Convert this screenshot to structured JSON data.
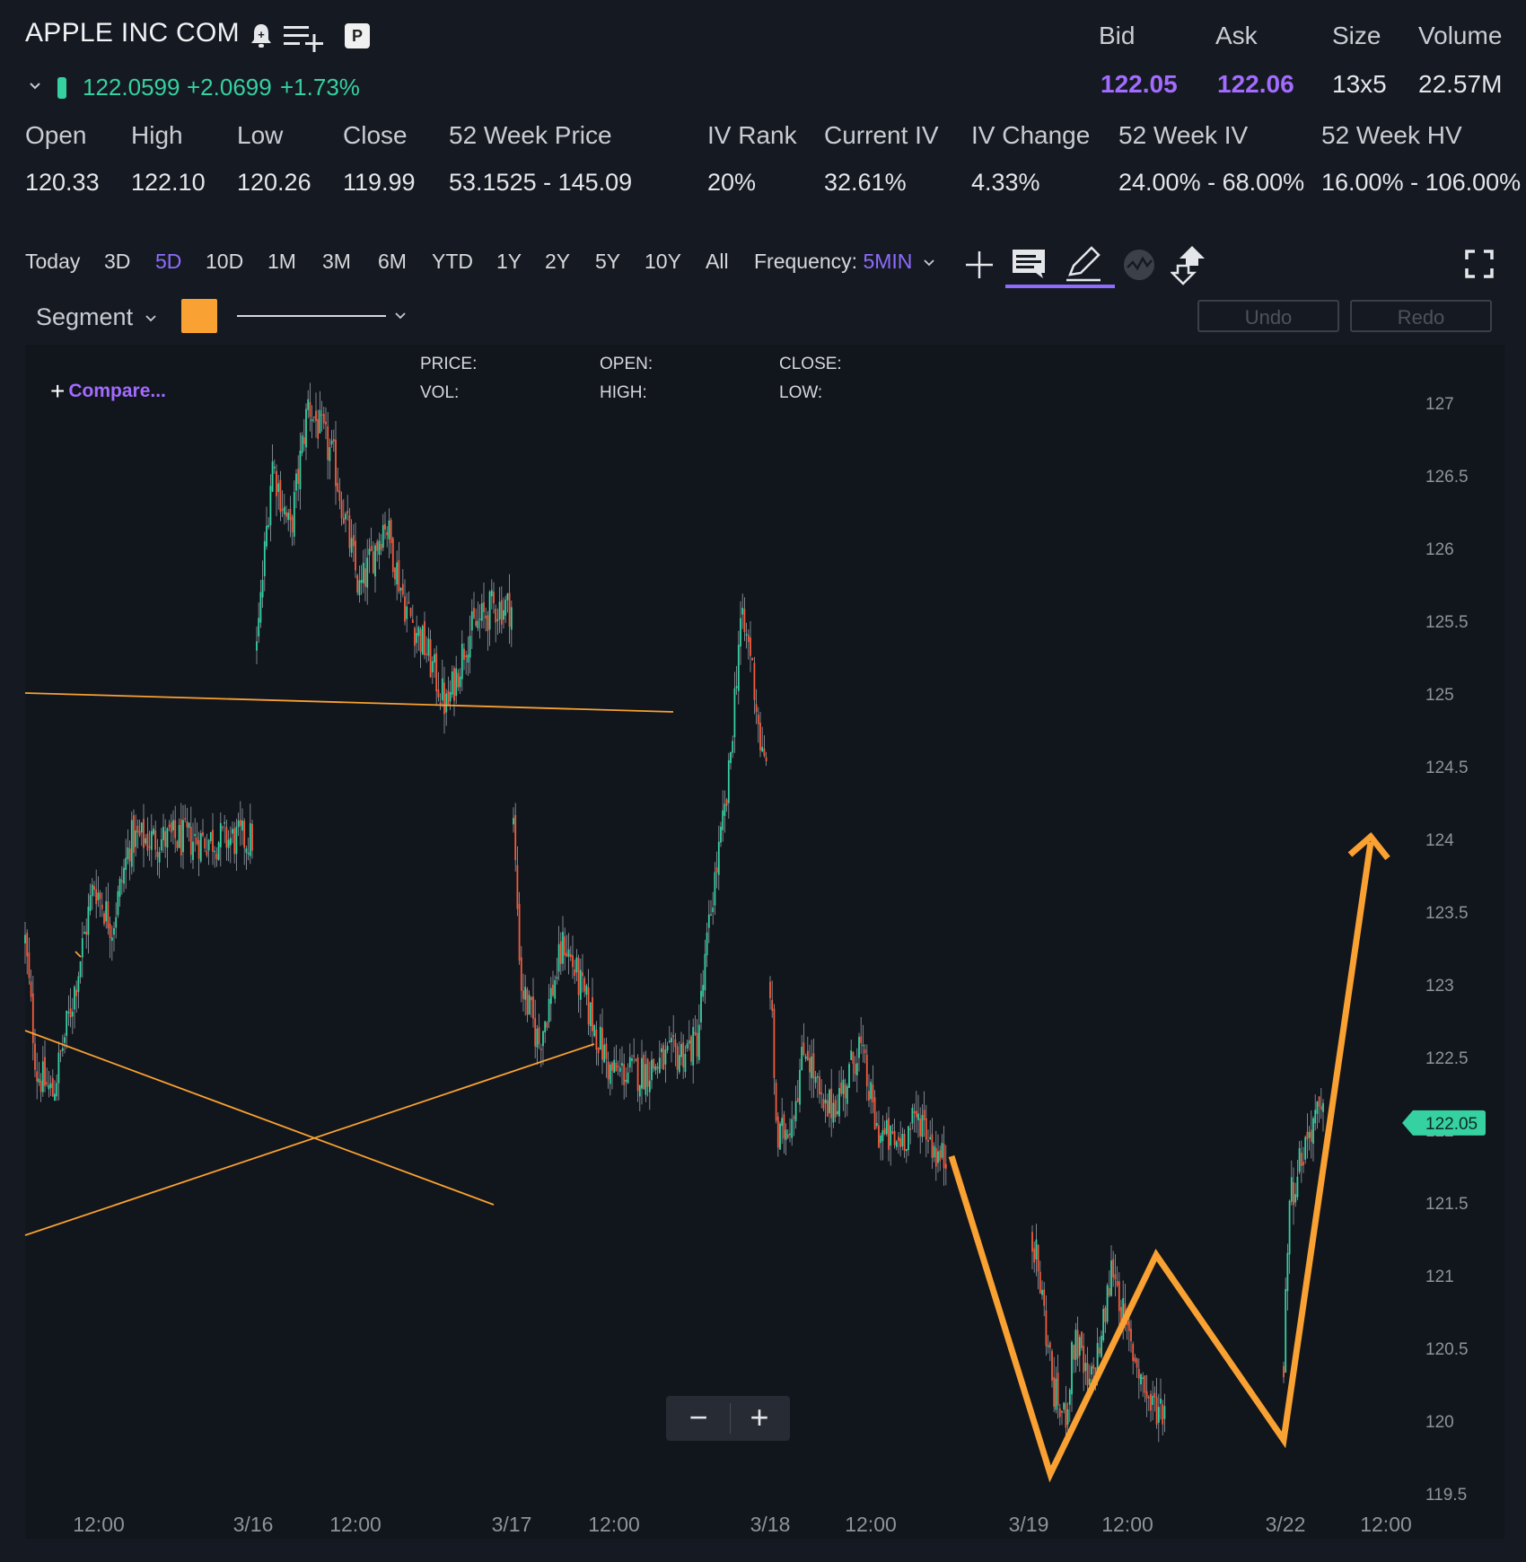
{
  "header": {
    "title": "APPLE INC COM",
    "price": "122.0599",
    "change": "+2.0699",
    "change_pct": "+1.73%",
    "badge": "P"
  },
  "quote": {
    "labels": [
      "Bid",
      "Ask",
      "Size",
      "Volume"
    ],
    "bid": "122.05",
    "ask": "122.06",
    "size": "13x5",
    "volume": "22.57M"
  },
  "stats": [
    {
      "label": "Open",
      "value": "120.33"
    },
    {
      "label": "High",
      "value": "122.10"
    },
    {
      "label": "Low",
      "value": "120.26"
    },
    {
      "label": "Close",
      "value": "119.99"
    },
    {
      "label": "52 Week Price",
      "value": "53.1525 - 145.09"
    },
    {
      "label": "IV Rank",
      "value": "20%"
    },
    {
      "label": "Current IV",
      "value": "32.61%"
    },
    {
      "label": "IV Change",
      "value": "4.33%"
    },
    {
      "label": "52 Week IV",
      "value": "24.00% - 68.00%"
    },
    {
      "label": "52 Week HV",
      "value": "16.00% - 106.00%"
    }
  ],
  "ranges": [
    "Today",
    "3D",
    "5D",
    "10D",
    "1M",
    "3M",
    "6M",
    "YTD",
    "1Y",
    "2Y",
    "5Y",
    "10Y",
    "All"
  ],
  "selected_range": "5D",
  "frequency": {
    "label": "Frequency:",
    "value": "5MIN"
  },
  "drawing": {
    "tool": "Segment",
    "color": "#f9a132",
    "undo": "Undo",
    "redo": "Redo"
  },
  "compare_label": "Compare...",
  "info_labels": {
    "price": "PRICE:",
    "vol": "VOL:",
    "open": "OPEN:",
    "high": "HIGH:",
    "close": "CLOSE:",
    "low": "LOW:"
  },
  "colors": {
    "background": "#151a22",
    "up": "#35d1a0",
    "down": "#f25c3c",
    "accent": "#8f6bff",
    "drawing": "#f9a132"
  },
  "chart_data": {
    "type": "candlestick",
    "frequency": "5MIN",
    "x_tick_labels": [
      "12:00",
      "3/16",
      "12:00",
      "3/17",
      "12:00",
      "3/18",
      "12:00",
      "3/19",
      "12:00",
      "3/22",
      "12:00"
    ],
    "y_tick_labels": [
      "127",
      "126.5",
      "126",
      "125.5",
      "125",
      "124.5",
      "124",
      "123.5",
      "123",
      "122.5",
      "122",
      "121.5",
      "121",
      "120.5",
      "120",
      "119.5"
    ],
    "ylim": [
      119.5,
      127.2
    ],
    "last_price_label": "122.05",
    "sessions": [
      {
        "name": "pre-3/16",
        "path": [
          [
            0,
            123.3
          ],
          [
            0.05,
            122.4
          ],
          [
            0.12,
            122.25
          ],
          [
            0.22,
            123.0
          ],
          [
            0.3,
            123.7
          ],
          [
            0.38,
            123.4
          ],
          [
            0.46,
            124.0
          ]
        ]
      },
      {
        "name": "3/16",
        "path": [
          [
            0,
            125.3
          ],
          [
            0.06,
            126.6
          ],
          [
            0.13,
            126.1
          ],
          [
            0.2,
            127.0
          ],
          [
            0.3,
            126.6
          ],
          [
            0.4,
            125.7
          ],
          [
            0.5,
            126.2
          ],
          [
            0.58,
            125.6
          ],
          [
            0.66,
            125.3
          ],
          [
            0.74,
            124.9
          ],
          [
            0.82,
            125.4
          ],
          [
            0.92,
            125.6
          ]
        ]
      },
      {
        "name": "3/17",
        "path": [
          [
            0,
            124.1
          ],
          [
            0.03,
            123.0
          ],
          [
            0.1,
            122.6
          ],
          [
            0.2,
            123.3
          ],
          [
            0.28,
            122.9
          ],
          [
            0.38,
            122.4
          ],
          [
            0.5,
            122.4
          ],
          [
            0.62,
            122.5
          ],
          [
            0.72,
            122.6
          ],
          [
            0.78,
            123.6
          ],
          [
            0.84,
            124.3
          ],
          [
            0.89,
            125.5
          ],
          [
            0.93,
            125.3
          ],
          [
            0.98,
            124.5
          ]
        ]
      },
      {
        "name": "3/18",
        "path": [
          [
            0,
            123.0
          ],
          [
            0.04,
            121.9
          ],
          [
            0.12,
            122.1
          ],
          [
            0.2,
            122.6
          ],
          [
            0.3,
            122.1
          ],
          [
            0.42,
            122.3
          ],
          [
            0.5,
            122.6
          ],
          [
            0.6,
            122.0
          ],
          [
            0.7,
            121.9
          ],
          [
            0.85,
            122.1
          ],
          [
            0.95,
            121.8
          ]
        ]
      },
      {
        "name": "3/19",
        "path": [
          [
            0,
            121.3
          ],
          [
            0.08,
            120.8
          ],
          [
            0.16,
            120.2
          ],
          [
            0.24,
            120.0
          ],
          [
            0.32,
            120.6
          ],
          [
            0.42,
            120.2
          ],
          [
            0.52,
            120.6
          ],
          [
            0.6,
            121.1
          ],
          [
            0.7,
            120.6
          ],
          [
            0.78,
            120.4
          ],
          [
            0.88,
            120.1
          ],
          [
            0.98,
            120.1
          ]
        ]
      },
      {
        "name": "3/22",
        "path": [
          [
            0,
            120.4
          ],
          [
            0.12,
            121.5
          ],
          [
            0.4,
            121.8
          ],
          [
            0.75,
            122.1
          ],
          [
            1.0,
            122.05
          ]
        ]
      }
    ]
  }
}
